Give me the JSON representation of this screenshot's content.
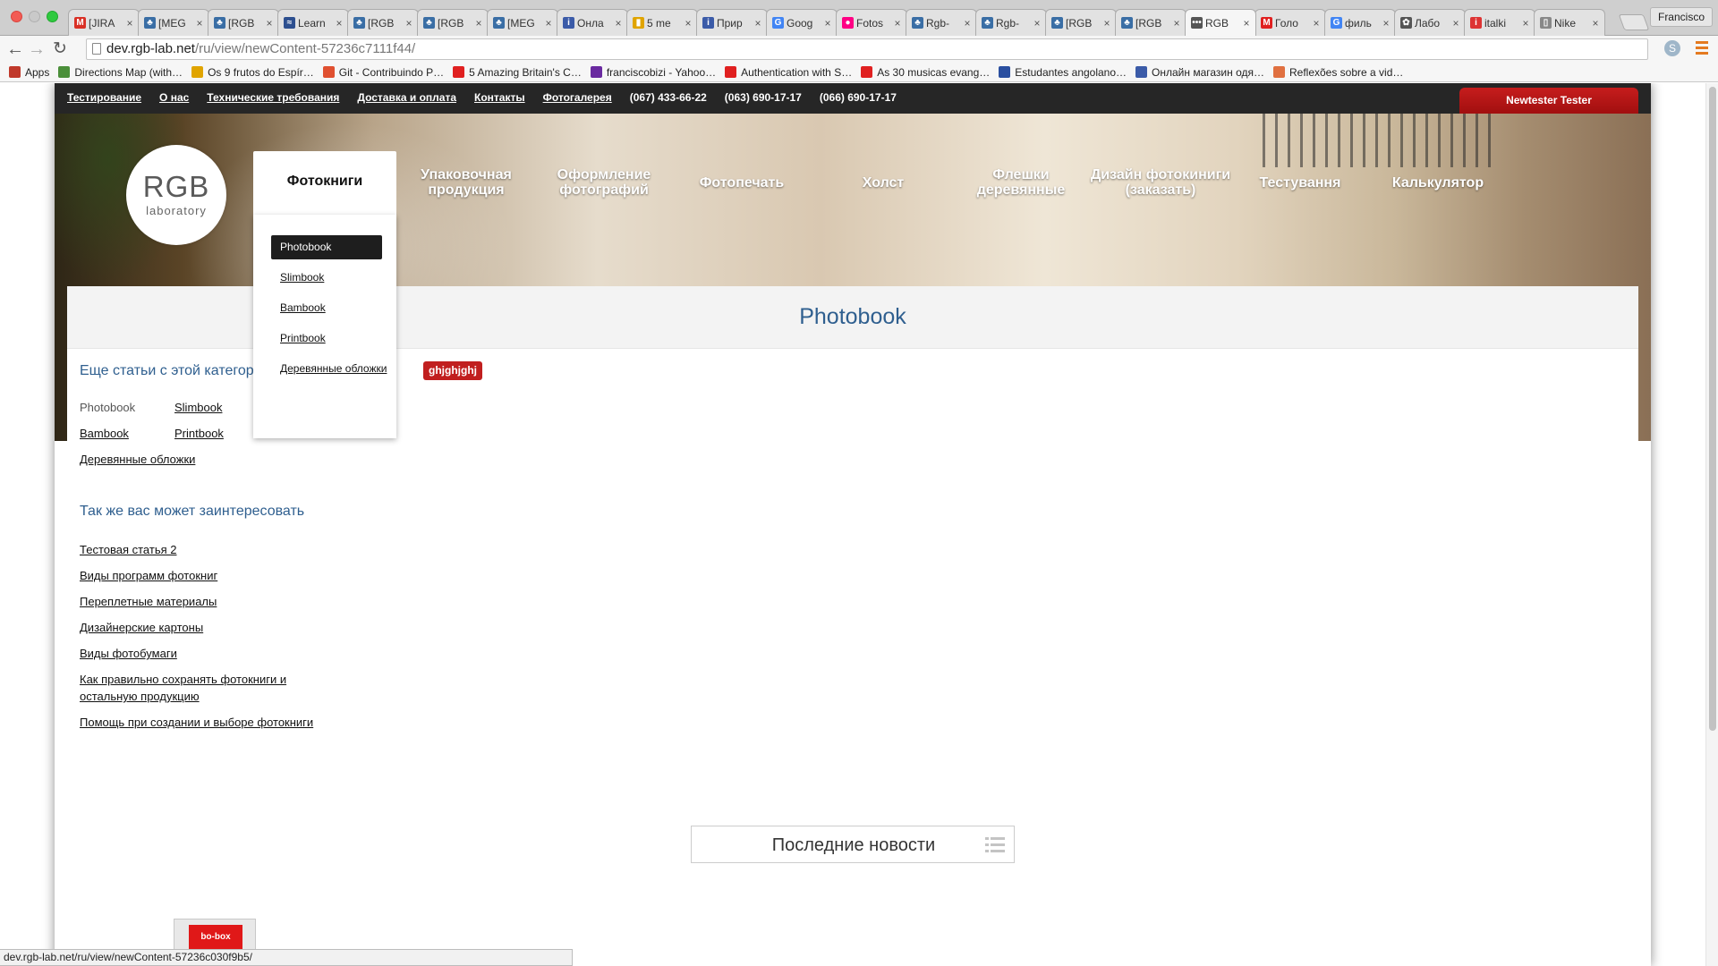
{
  "browser": {
    "tabs": [
      {
        "title": "[JIRA",
        "color": "#d93025",
        "glyph": "M",
        "active": false
      },
      {
        "title": "[MEG",
        "color": "#3a6ea5",
        "glyph": "♣",
        "active": false
      },
      {
        "title": "[RGB",
        "color": "#3a6ea5",
        "glyph": "♣",
        "active": false
      },
      {
        "title": "Learn",
        "color": "#2d4f8f",
        "glyph": "≈",
        "active": false
      },
      {
        "title": "[RGB",
        "color": "#3a6ea5",
        "glyph": "♣",
        "active": false
      },
      {
        "title": "[RGB",
        "color": "#3a6ea5",
        "glyph": "♣",
        "active": false
      },
      {
        "title": "[MEG",
        "color": "#3a6ea5",
        "glyph": "♣",
        "active": false
      },
      {
        "title": "Онла",
        "color": "#3b5ba8",
        "glyph": "i",
        "active": false
      },
      {
        "title": "5 me",
        "color": "#e0a400",
        "glyph": "▮",
        "active": false
      },
      {
        "title": "Прир",
        "color": "#3b5ba8",
        "glyph": "i",
        "active": false
      },
      {
        "title": "Goog",
        "color": "#4285f4",
        "glyph": "G",
        "active": false
      },
      {
        "title": "Fotos",
        "color": "#ff0084",
        "glyph": "●",
        "active": false
      },
      {
        "title": "Rgb-",
        "color": "#3a6ea5",
        "glyph": "♣",
        "active": false
      },
      {
        "title": "Rgb-",
        "color": "#3a6ea5",
        "glyph": "♣",
        "active": false
      },
      {
        "title": "[RGB",
        "color": "#3a6ea5",
        "glyph": "♣",
        "active": false
      },
      {
        "title": "[RGB",
        "color": "#3a6ea5",
        "glyph": "♣",
        "active": false
      },
      {
        "title": "RGB",
        "color": "#555555",
        "glyph": "•••",
        "active": true
      },
      {
        "title": "Голо",
        "color": "#e02020",
        "glyph": "M",
        "active": false
      },
      {
        "title": "филь",
        "color": "#4285f4",
        "glyph": "G",
        "active": false
      },
      {
        "title": "Лабо",
        "color": "#555555",
        "glyph": "✿",
        "active": false
      },
      {
        "title": "italki",
        "color": "#d33",
        "glyph": "i",
        "active": false
      },
      {
        "title": "Nike",
        "color": "#888888",
        "glyph": "▯",
        "active": false
      }
    ],
    "profile_name": "Francisco",
    "url_host": "dev.rgb-lab.net",
    "url_path": "/ru/view/newContent-57236c7111f44/",
    "ext_label": "S",
    "bookmarks": [
      {
        "label": "Apps",
        "color": "#c0392b"
      },
      {
        "label": "Directions Map (with…",
        "color": "#4b8f3a"
      },
      {
        "label": "Os 9 frutos do Espír…",
        "color": "#e0a400"
      },
      {
        "label": "Git - Contribuindo P…",
        "color": "#e05030"
      },
      {
        "label": "5 Amazing Britain's C…",
        "color": "#e02020"
      },
      {
        "label": "franciscobizi - Yahoo…",
        "color": "#6a2aa0"
      },
      {
        "label": "Authentication with S…",
        "color": "#e02020"
      },
      {
        "label": "As 30 musicas evang…",
        "color": "#e02020"
      },
      {
        "label": "Estudantes angolano…",
        "color": "#2a4fa0"
      },
      {
        "label": "Онлайн магазин одя…",
        "color": "#3b5ba8"
      },
      {
        "label": "Reflexões sobre a vid…",
        "color": "#e07040"
      }
    ],
    "status_url": "dev.rgb-lab.net/ru/view/newContent-57236c030f9b5/"
  },
  "topbar": {
    "links": [
      "Тестирование",
      "О нас",
      "Технические требования",
      "Доставка и оплата",
      "Контакты",
      "Фотогалерея"
    ],
    "phones": [
      "(067) 433-66-22",
      "(063) 690-17-17",
      "(066) 690-17-17"
    ],
    "user_button": "Newtester Tester"
  },
  "logo": {
    "big": "RGB",
    "small": "laboratory"
  },
  "nav": {
    "items": [
      "Фотокниги",
      "Упаковочная продукция",
      "Оформление фотографий",
      "Фотопечать",
      "Холст",
      "Флешки деревянные",
      "Дизайн фотокиниги (заказать)",
      "Тестування",
      "Калькулятор"
    ],
    "active_index": 0
  },
  "dropdown": {
    "items": [
      "Photobook",
      "Slimbook",
      "Bambook",
      "Printbook",
      "Деревянные обложки"
    ],
    "selected_index": 0
  },
  "content": {
    "title": "Photobook",
    "more_title": "Еще статьи с этой категории",
    "badge": "ghjghjghj",
    "category_links": [
      "Photobook",
      "Slimbook",
      "Bambook",
      "Printbook",
      "Деревянные обложки"
    ],
    "also_title": "Так же вас может заинтересовать",
    "also_links": [
      "Тестовая статья 2",
      "Виды программ фотокниг",
      "Переплетные материалы",
      "Дизайнерские картоны",
      "Виды фотобумаги",
      "Как правильно сохранять фотокниги и остальную продукцию",
      "Помощь при создании и выборе фотокниги"
    ],
    "news_label": "Последние новости",
    "bobox_label": "bo-box"
  }
}
